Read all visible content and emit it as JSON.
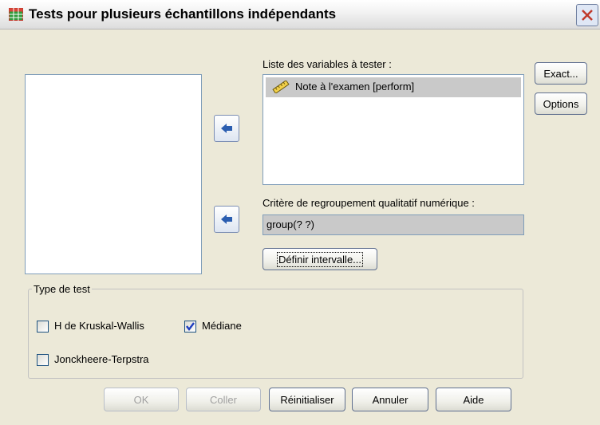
{
  "window": {
    "title": "Tests pour plusieurs échantillons indépendants"
  },
  "labels": {
    "variables_list": "Liste des variables à tester :",
    "grouping": "Critère de regroupement qualitatif numérique :",
    "test_type": "Type de test"
  },
  "variables": [
    {
      "label": "Note à l'examen [perform]",
      "icon": "ruler-scale-icon"
    }
  ],
  "grouping_value": "group(? ?)",
  "buttons": {
    "exact": "Exact...",
    "options": "Options",
    "define_range": "Définir intervalle...",
    "ok": "OK",
    "paste": "Coller",
    "reset": "Réinitialiser",
    "cancel": "Annuler",
    "help": "Aide"
  },
  "checkboxes": [
    {
      "label": "H de Kruskal-Wallis",
      "checked": false
    },
    {
      "label": "Médiane",
      "checked": true
    },
    {
      "label": "Jonckheere-Terpstra",
      "checked": false
    }
  ]
}
